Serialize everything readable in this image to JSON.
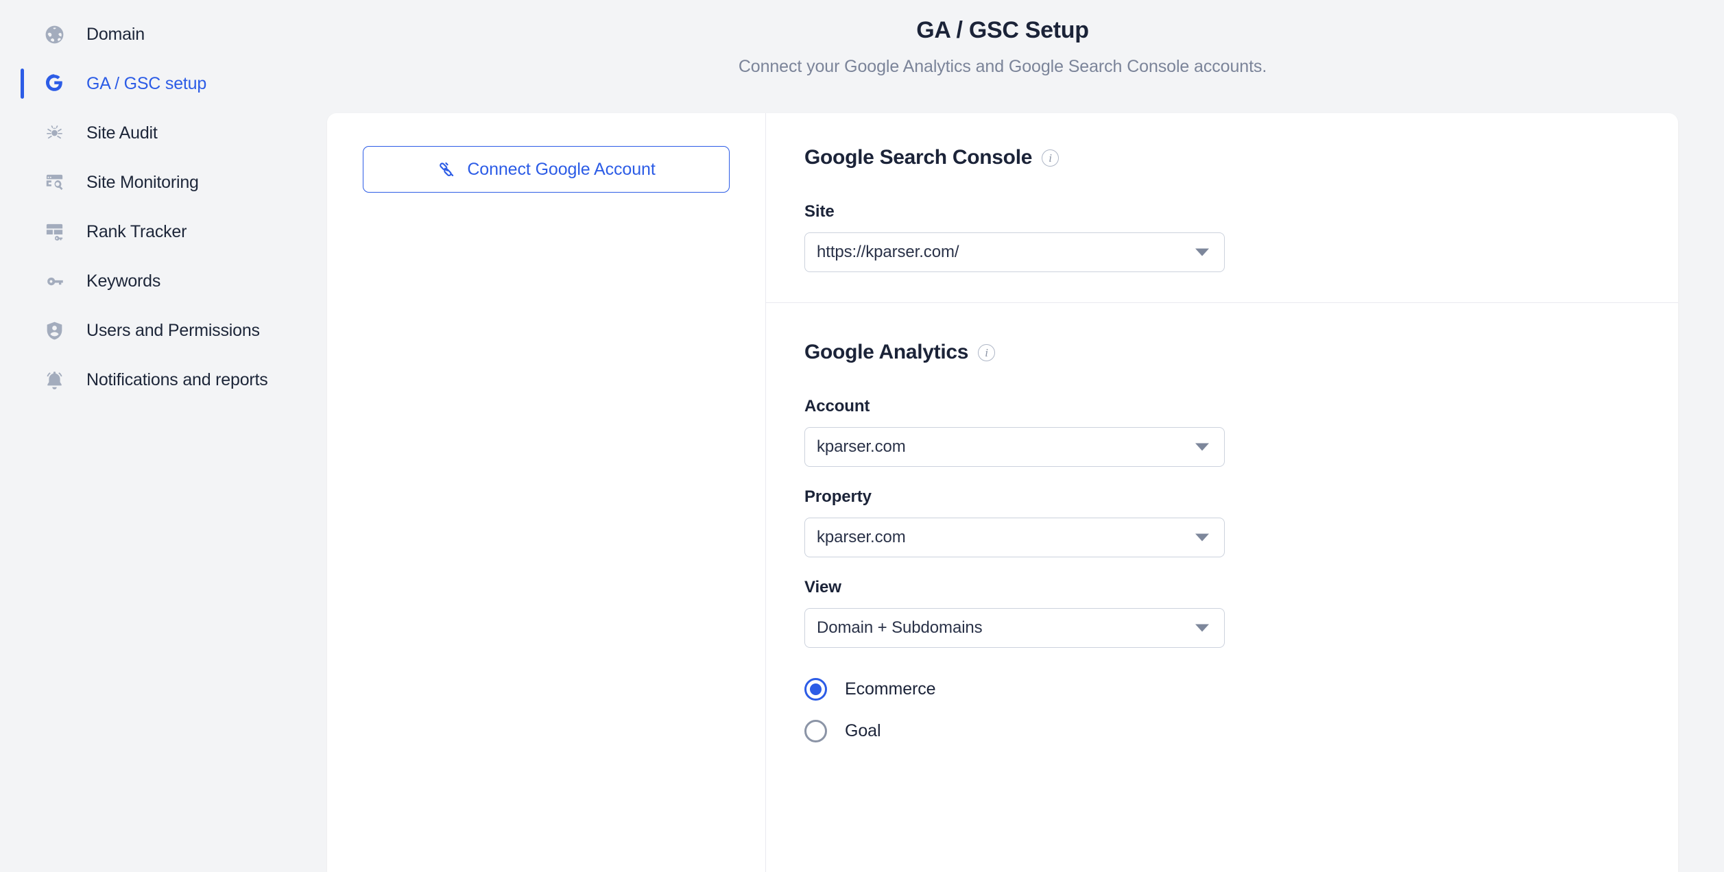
{
  "sidebar": {
    "items": [
      {
        "label": "Domain",
        "icon": "globe-icon",
        "active": false
      },
      {
        "label": "GA / GSC setup",
        "icon": "google-g-icon",
        "active": true
      },
      {
        "label": "Site Audit",
        "icon": "spider-icon",
        "active": false
      },
      {
        "label": "Site Monitoring",
        "icon": "site-search-icon",
        "active": false
      },
      {
        "label": "Rank Tracker",
        "icon": "rank-layout-key-icon",
        "active": false
      },
      {
        "label": "Keywords",
        "icon": "key-icon",
        "active": false
      },
      {
        "label": "Users and Permissions",
        "icon": "shield-user-icon",
        "active": false
      },
      {
        "label": "Notifications and reports",
        "icon": "bell-icon",
        "active": false
      }
    ]
  },
  "header": {
    "title": "GA / GSC Setup",
    "subtitle": "Connect your Google Analytics and Google Search Console accounts."
  },
  "left_panel": {
    "connect_button_label": "Connect Google Account",
    "connect_button_icon": "plug-connect-icon"
  },
  "gsc": {
    "title": "Google Search Console",
    "info_icon": "info-icon",
    "site": {
      "label": "Site",
      "value": "https://kparser.com/",
      "caret_icon": "chevron-down-icon"
    }
  },
  "ga": {
    "title": "Google Analytics",
    "info_icon": "info-icon",
    "account": {
      "label": "Account",
      "value": "kparser.com",
      "caret_icon": "chevron-down-icon"
    },
    "property": {
      "label": "Property",
      "value": "kparser.com",
      "caret_icon": "chevron-down-icon"
    },
    "view": {
      "label": "View",
      "value": "Domain + Subdomains",
      "caret_icon": "chevron-down-icon"
    },
    "tracking_options": [
      {
        "label": "Ecommerce",
        "selected": true
      },
      {
        "label": "Goal",
        "selected": false
      }
    ]
  },
  "colors": {
    "accent": "#2c5ce6",
    "page_bg": "#f3f4f6",
    "card_bg": "#ffffff",
    "text_primary": "#1b2338",
    "text_muted": "#7b8499",
    "border": "#ccd2dd",
    "icon_muted": "#a3acbd"
  }
}
